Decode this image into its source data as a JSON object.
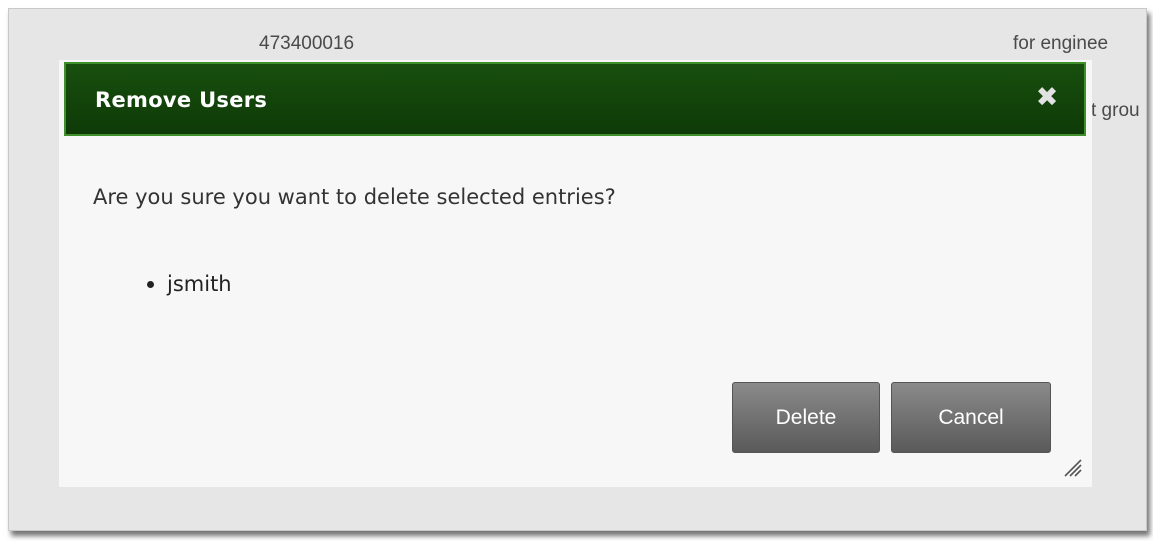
{
  "background": {
    "id_fragment": "473400016",
    "desc_fragment": "for enginee",
    "group_fragment": "t grou"
  },
  "dialog": {
    "title": "Remove Users",
    "close_glyph": "✖",
    "message": "Are you sure you want to delete selected entries?",
    "entries": [
      "jsmith"
    ],
    "delete_label": "Delete",
    "cancel_label": "Cancel"
  },
  "colors": {
    "titlebar": "#184f0e",
    "titlebar_border": "#3f8f2b",
    "button": "#6e6e6e",
    "dialog_body": "#f7f7f7"
  },
  "icons": {
    "close": "close-icon",
    "resize": "resize-grip-icon"
  }
}
